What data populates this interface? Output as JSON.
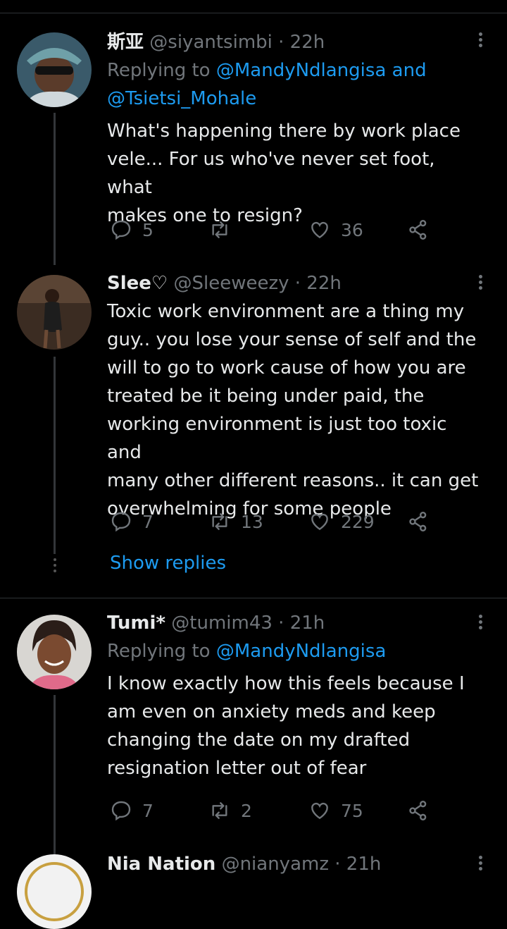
{
  "tweets": [
    {
      "name": "斯亚",
      "handle": "@siyantsimbi",
      "time": "· 22h",
      "replying_prefix": "Replying to ",
      "replying_to_1": "@MandyNdlangisa",
      "replying_and": " and",
      "replying_to_2": "@Tsietsi_Mohale",
      "text_lines": [
        "What's happening there by work place",
        "vele... For us who've never set foot, what",
        "makes one to resign?"
      ],
      "replies": "5",
      "retweets": "",
      "likes": "36"
    },
    {
      "name": "Slee♡",
      "handle": "@Sleeweezy",
      "time": "· 22h",
      "text_lines": [
        "Toxic work environment are a thing my",
        "guy.. you lose your sense of self and the",
        "will to go to work cause of how you are",
        "treated be it being under paid, the",
        "working environment is just too toxic and",
        "many other different reasons.. it can get",
        "overwhelming for some people"
      ],
      "replies": "7",
      "retweets": "13",
      "likes": "229",
      "show_replies": "Show replies"
    },
    {
      "name": "Tumi*",
      "handle": "@tumim43",
      "time": "· 21h",
      "replying_prefix": "Replying to ",
      "replying_to_1": "@MandyNdlangisa",
      "text_lines": [
        "I know exactly how this feels because I",
        "am even on anxiety meds and keep",
        "changing the date on my drafted",
        "resignation letter out of fear"
      ],
      "replies": "7",
      "retweets": "2",
      "likes": "75"
    },
    {
      "name": "Nia Nation",
      "handle": "@nianyamz",
      "time": "· 21h"
    }
  ],
  "colors": {
    "accent": "#1d9bf0",
    "muted": "#71767b",
    "background": "#000000"
  },
  "icons": [
    "reply-icon",
    "retweet-icon",
    "like-icon",
    "share-icon",
    "more-icon"
  ]
}
